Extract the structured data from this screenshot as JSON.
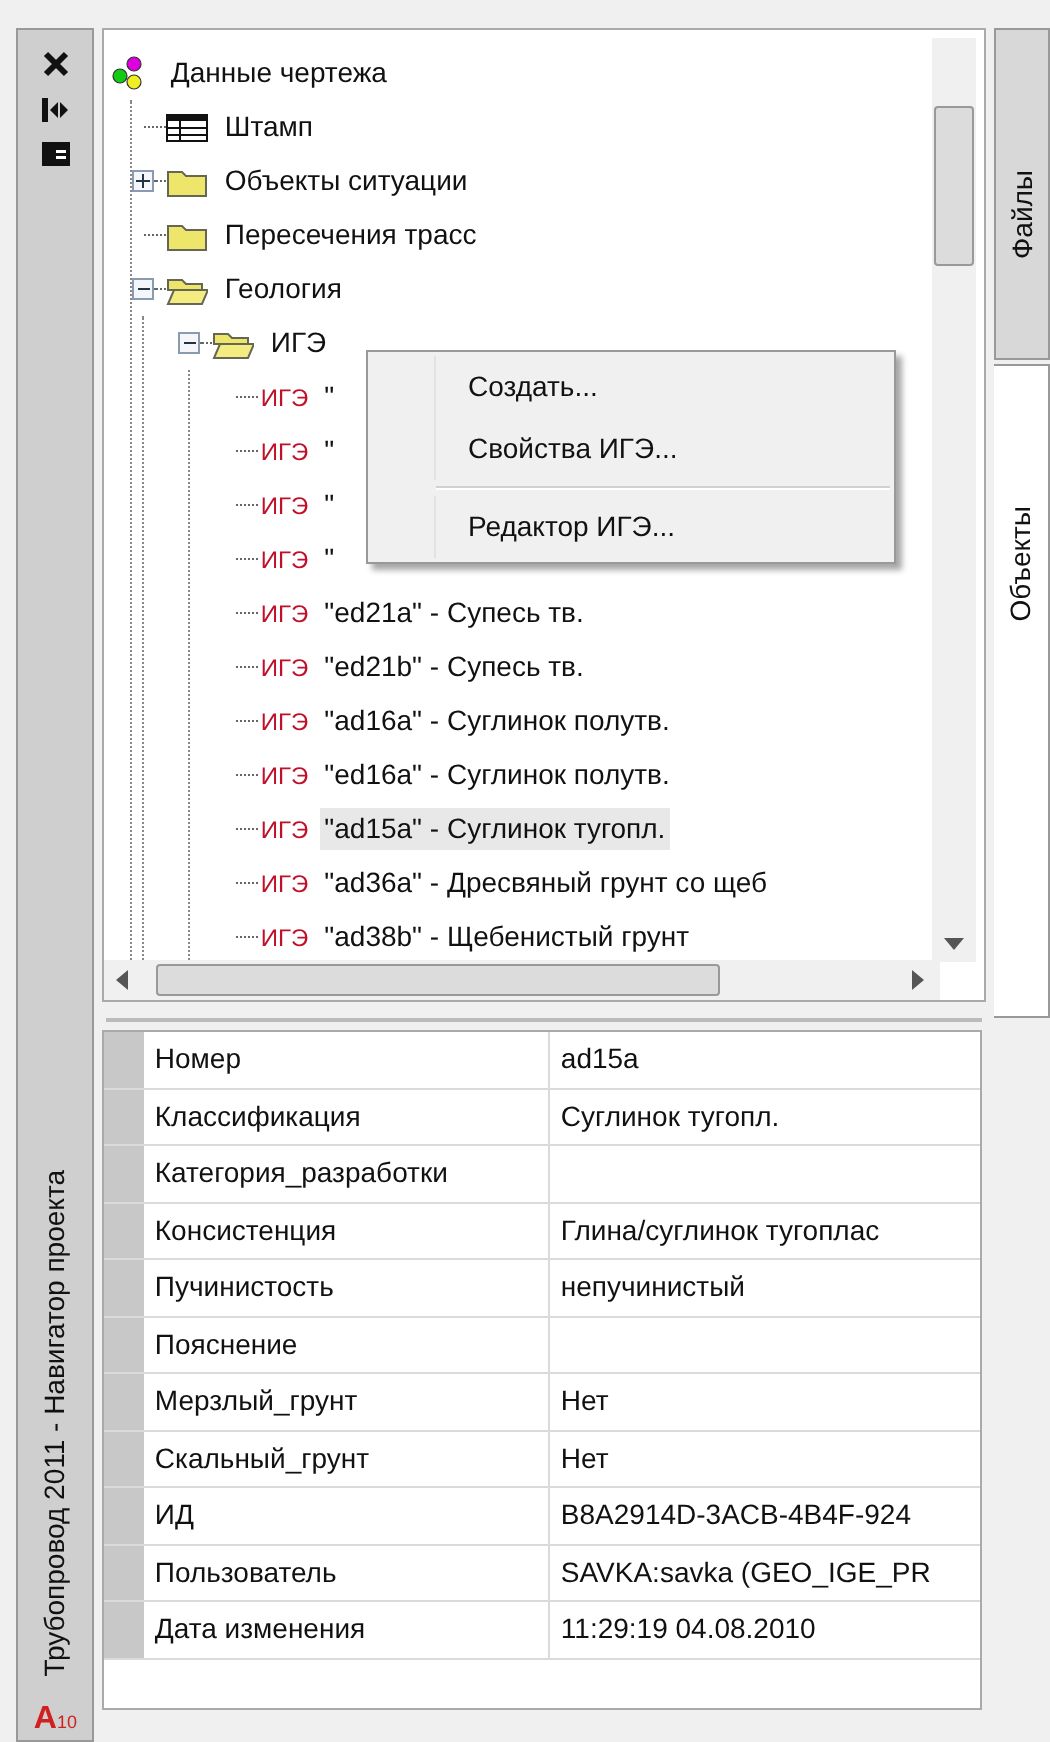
{
  "palette": {
    "title": "Трубопровод 2011 - Навигатор проекта",
    "logo": "A",
    "logo_sub": "10"
  },
  "side_tabs": [
    {
      "label": "Файлы",
      "selected": false
    },
    {
      "label": "Объекты",
      "selected": true
    }
  ],
  "tree": {
    "label": "Данные чертежа",
    "kind": "root",
    "children": [
      {
        "label": "Штамп",
        "kind": "table"
      },
      {
        "label": "Объекты ситуации",
        "kind": "folder",
        "expanded": false
      },
      {
        "label": "Пересечения трасс",
        "kind": "folder"
      },
      {
        "label": "Геология",
        "kind": "folder",
        "expanded": true,
        "children": [
          {
            "label": "ИГЭ",
            "kind": "folder",
            "expanded": true,
            "children": [
              {
                "tag": "ИГЭ",
                "label": "\"",
                "kind": "ige",
                "selected": false
              },
              {
                "tag": "ИГЭ",
                "label": "\"",
                "kind": "ige",
                "selected": false
              },
              {
                "tag": "ИГЭ",
                "label": "\"",
                "kind": "ige",
                "selected": false
              },
              {
                "tag": "ИГЭ",
                "label": "\"",
                "kind": "ige",
                "selected": false
              },
              {
                "tag": "ИГЭ",
                "label": "\"ed21a\" - Супесь тв.",
                "kind": "ige",
                "selected": false
              },
              {
                "tag": "ИГЭ",
                "label": "\"ed21b\" - Супесь тв.",
                "kind": "ige",
                "selected": false
              },
              {
                "tag": "ИГЭ",
                "label": "\"ad16a\" - Суглинок полутв.",
                "kind": "ige",
                "selected": false
              },
              {
                "tag": "ИГЭ",
                "label": "\"ed16a\" - Суглинок полутв.",
                "kind": "ige",
                "selected": false
              },
              {
                "tag": "ИГЭ",
                "label": "\"ad15a\" - Суглинок тугопл.",
                "kind": "ige",
                "selected": true
              },
              {
                "tag": "ИГЭ",
                "label": "\"ad36a\" - Дресвяный грунт со щеб",
                "kind": "ige",
                "selected": false
              },
              {
                "tag": "ИГЭ",
                "label": "\"ad38b\" - Щебенистый грунт",
                "kind": "ige",
                "selected": false
              }
            ]
          }
        ]
      }
    ]
  },
  "context_menu": [
    {
      "label": "Создать...",
      "kind": "item"
    },
    {
      "label": "Свойства ИГЭ...",
      "kind": "item"
    },
    {
      "kind": "separator"
    },
    {
      "label": "Редактор ИГЭ...",
      "kind": "item"
    }
  ],
  "properties": [
    {
      "name": "Номер",
      "value": "ad15a"
    },
    {
      "name": "Классификация",
      "value": "Суглинок тугопл."
    },
    {
      "name": "Категория_разработки"
    },
    {
      "name": "Консистенция",
      "value": "Глина/суглинок тугоплас"
    },
    {
      "name": "Пучинистость",
      "value": "непучинистый"
    },
    {
      "name": "Пояснение"
    },
    {
      "name": "Мерзлый_грунт",
      "value": "Нет"
    },
    {
      "name": "Скальный_грунт",
      "value": "Нет"
    },
    {
      "name": "ИД",
      "value": "B8A2914D-3ACB-4B4F-924"
    },
    {
      "name": "Пользователь",
      "value": "SAVKA:savka (GEO_IGE_PR"
    },
    {
      "name": "Дата изменения",
      "value": "11:29:19 04.08.2010"
    }
  ]
}
